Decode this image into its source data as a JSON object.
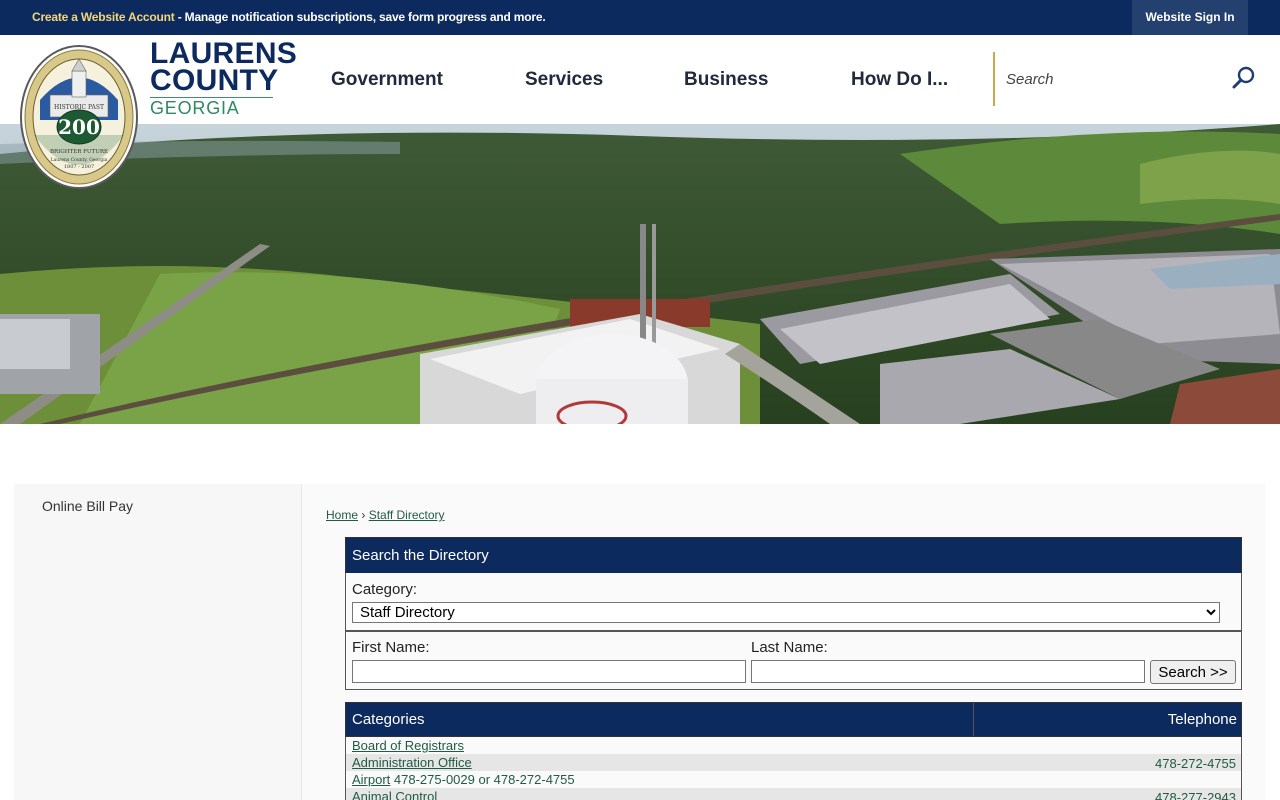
{
  "topbar": {
    "create_account_link": "Create a Website Account",
    "message": " - Manage notification subscriptions, save form progress and more.",
    "sign_in": "Website Sign In"
  },
  "brand": {
    "line1": "LAURENS",
    "line2": "COUNTY",
    "line3": "GEORGIA",
    "seal_text": {
      "center": "200",
      "top": "HISTORIC PAST",
      "bottom": "BRIGHTER FUTURE",
      "county": "Laurens County, Georgia",
      "years": "1807 - 2007"
    }
  },
  "nav": {
    "items": [
      "Government",
      "Services",
      "Business",
      "How Do I..."
    ]
  },
  "search": {
    "placeholder": "Search",
    "icon": "search-icon"
  },
  "sidebar": {
    "items": [
      "Online Bill Pay"
    ]
  },
  "breadcrumb": {
    "home": "Home",
    "separator": "›",
    "current": "Staff Directory"
  },
  "directory_search": {
    "title": "Search the Directory",
    "category_label": "Category:",
    "category_selected": "Staff Directory",
    "first_name_label": "First Name:",
    "last_name_label": "Last Name:",
    "submit_label": "Search >>"
  },
  "categories_table": {
    "headers": [
      "Categories",
      "Telephone"
    ],
    "rows": [
      {
        "name": "Board of Registrars",
        "extra": "",
        "phone": ""
      },
      {
        "name": "Administration Office",
        "extra": "",
        "phone": "478-272-4755"
      },
      {
        "name": "Airport",
        "extra": " 478-275-0029 or 478-272-4755",
        "phone": ""
      },
      {
        "name": "Animal Control",
        "extra": "",
        "phone": "478-277-2943"
      }
    ]
  },
  "colors": {
    "navy": "#0d2a5e",
    "gold": "#f2d57a",
    "green_link": "#1f5c42",
    "accent_green": "#2d8a63"
  }
}
